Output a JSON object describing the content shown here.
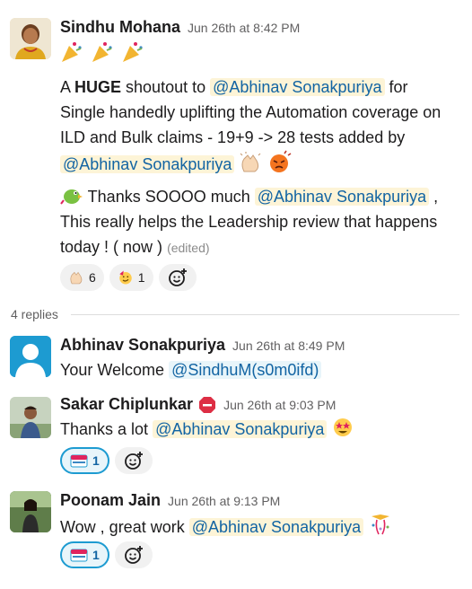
{
  "parent": {
    "author": "Sindhu Mohana",
    "time": "Jun 26th at 8:42 PM",
    "line1_a": "A ",
    "line1_bold": "HUGE",
    "line1_b": " shoutout to ",
    "mention": "@Abhinav Sonakpuriya",
    "line1_c": " for",
    "line2": "Single handedly uplifting the Automation coverage on",
    "line3": "ILD and Bulk claims - 19+9 -> 28 tests added by",
    "line5_a": " Thanks SOOOO much ",
    "line5_b": " ,",
    "line6": "This really helps the Leadership review that happens",
    "line7": "today ! ( now ) ",
    "edited": "(edited)",
    "reactions": [
      {
        "icon": "clap-emoji",
        "count": "6"
      },
      {
        "icon": "party-face-emoji",
        "count": "1"
      }
    ]
  },
  "replies_label": "4 replies",
  "replies": [
    {
      "author": "Abhinav Sonakpuriya",
      "time": "Jun 26th at 8:49 PM",
      "text": "Your Welcome ",
      "mention": "@SindhuM(s0m0ifd)"
    },
    {
      "author": "Sakar Chiplunkar",
      "time": "Jun 26th at 9:03 PM",
      "text": "Thanks a lot ",
      "mention": "@Abhinav Sonakpuriya",
      "reaction_count": "1"
    },
    {
      "author": "Poonam Jain",
      "time": "Jun 26th at 9:13 PM",
      "text": "Wow , great work ",
      "mention": "@Abhinav Sonakpuriya",
      "reaction_count": "1"
    }
  ],
  "colors": {
    "mention_text": "#1264a3",
    "mention_bg": "#fdf4d7",
    "active_reaction_border": "#1d9bd1"
  }
}
